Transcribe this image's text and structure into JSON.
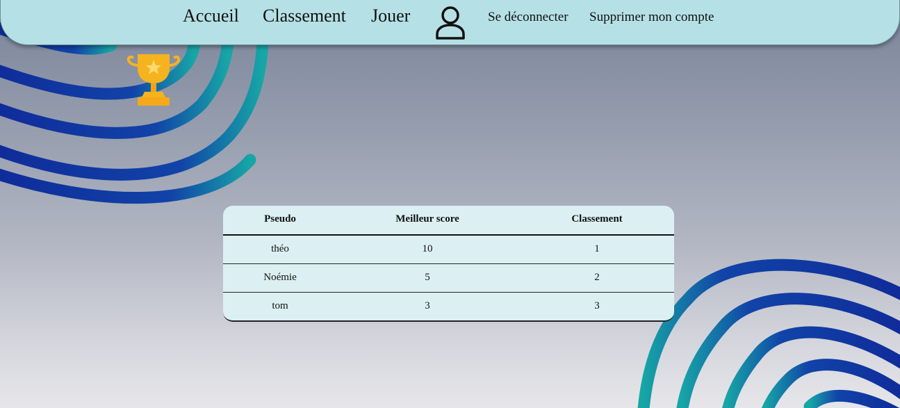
{
  "nav": {
    "home": "Accueil",
    "ranking": "Classement",
    "play": "Jouer",
    "logout": "Se déconnecter",
    "delete_account": "Supprimer mon compte",
    "user_icon": "user-icon"
  },
  "trophy_icon": "trophy-icon",
  "table": {
    "headers": [
      "Pseudo",
      "Meilleur score",
      "Classement"
    ],
    "rows": [
      [
        "théo",
        "10",
        "1"
      ],
      [
        "Noémie",
        "5",
        "2"
      ],
      [
        "tom",
        "3",
        "3"
      ]
    ]
  },
  "colors": {
    "navbar": "#b5e0e6",
    "table_bg": "#dcf0f3",
    "wave_dark": "#0f2a99",
    "wave_teal": "#16a7a8",
    "trophy": "#f5b320"
  }
}
